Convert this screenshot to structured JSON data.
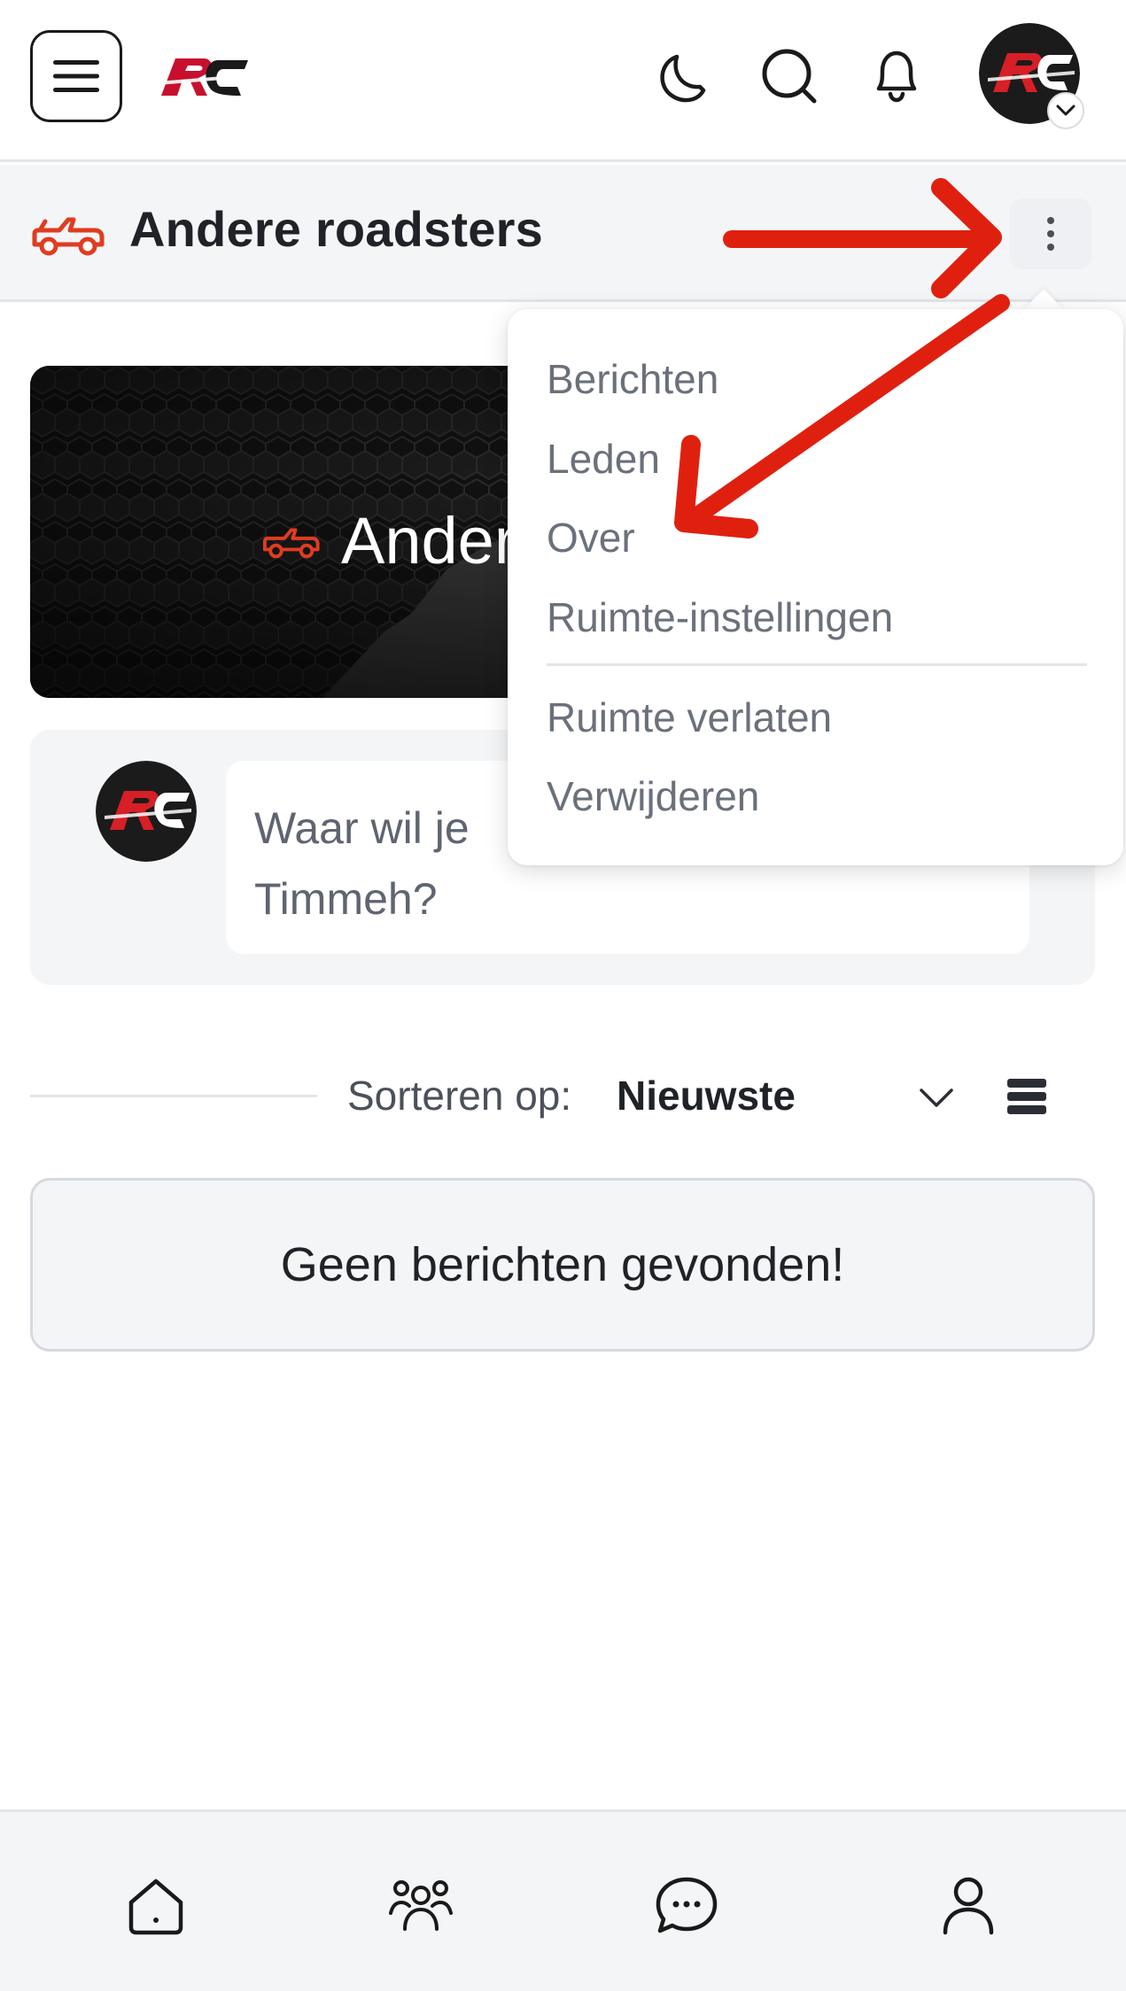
{
  "header": {
    "menu_icon": "hamburger-menu-icon",
    "logo_text": "RC",
    "icons": [
      "moon-icon",
      "search-icon",
      "bell-icon"
    ],
    "avatar_text": "RC"
  },
  "space": {
    "title": "Andere roadsters",
    "icon": "convertible-car-icon",
    "more_icon": "kebab-menu-icon"
  },
  "banner": {
    "title": "Ander"
  },
  "composer": {
    "placeholder": "Waar wil je",
    "placeholder_line2": "Timmeh?"
  },
  "sort": {
    "label": "Sorteren op:",
    "value": "Nieuwste"
  },
  "feed": {
    "empty_message": "Geen berichten gevonden!"
  },
  "dropdown": {
    "items": [
      {
        "label": "Berichten"
      },
      {
        "label": "Leden"
      },
      {
        "label": "Over"
      },
      {
        "label": "Ruimte-instellingen"
      },
      {
        "label": "Ruimte verlaten"
      },
      {
        "label": "Verwijderen"
      }
    ]
  },
  "bottom_nav": {
    "icons": [
      "home-icon",
      "members-icon",
      "chat-icon",
      "profile-icon"
    ]
  },
  "colors": {
    "brand_red": "#d42a2a",
    "annotation_red": "#e0200f",
    "surface": "#f4f5f7",
    "text": "#1f2328",
    "muted": "#6b717b"
  }
}
